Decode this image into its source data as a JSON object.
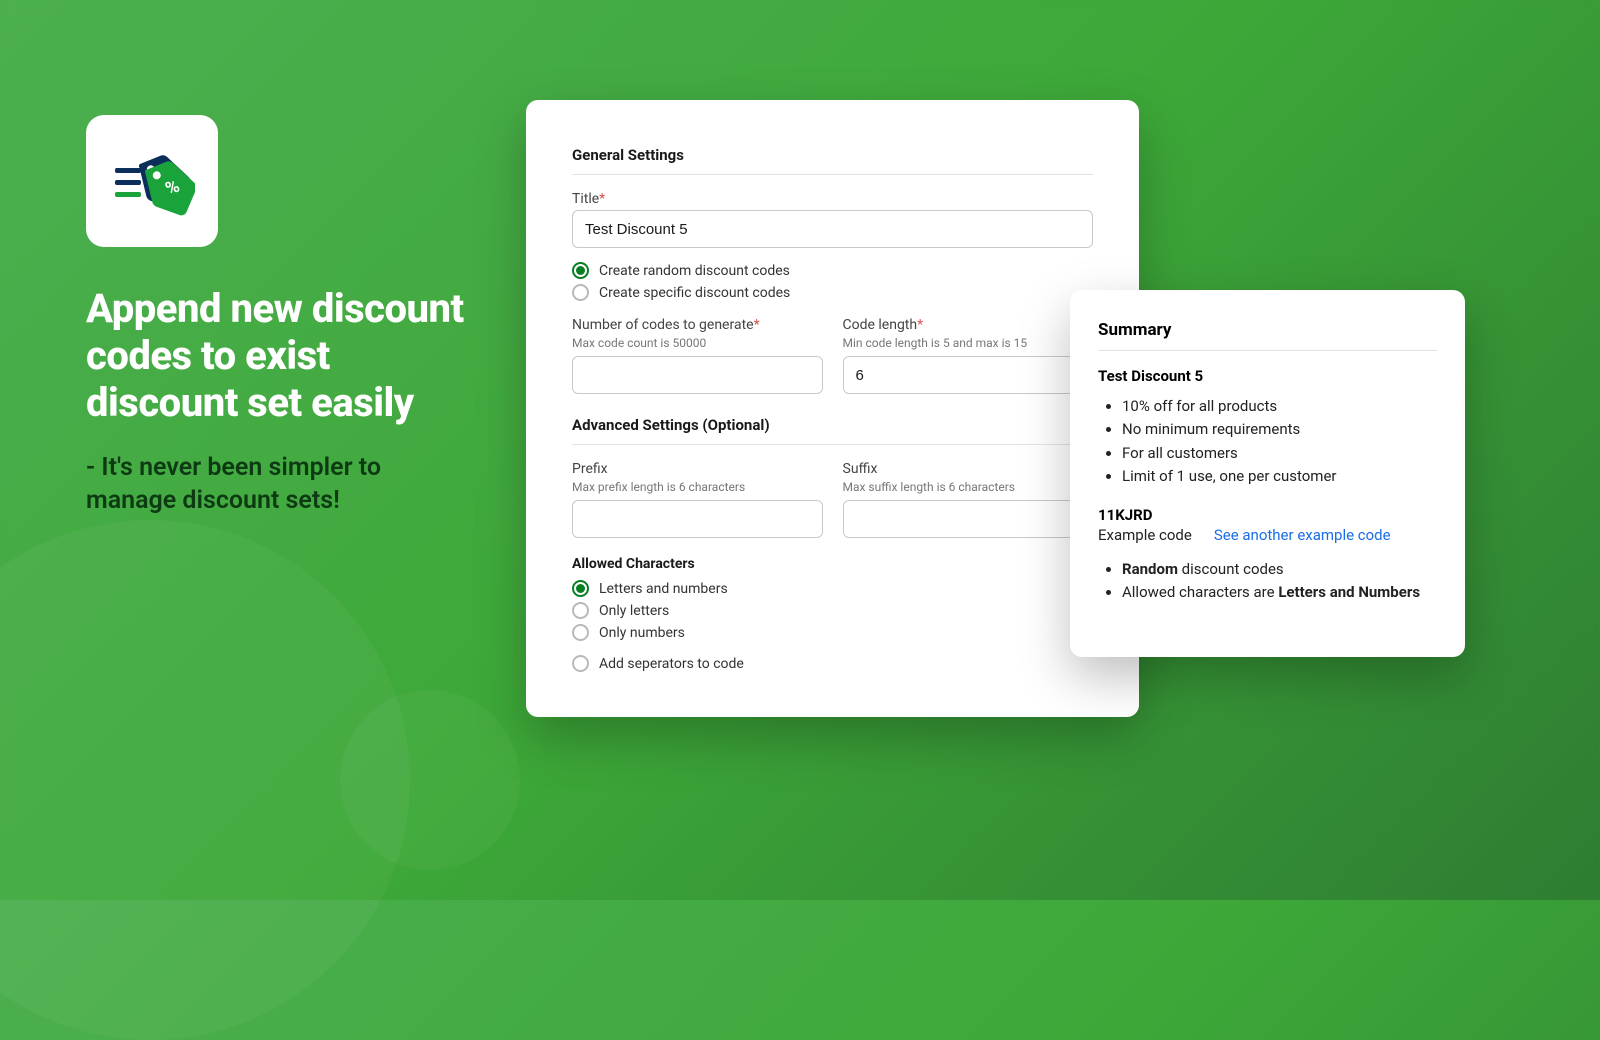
{
  "left": {
    "headline": "Append new discount codes to exist discount set easily",
    "subhead": "- It's never been simpler to manage  discount sets!"
  },
  "form": {
    "general_heading": "General Settings",
    "title_label": "Title",
    "title_value": "Test Discount 5",
    "radio_random": "Create random discount codes",
    "radio_specific": "Create specific discount codes",
    "num_label": "Number of codes to generate",
    "num_helper": "Max code count is 50000",
    "num_value": "",
    "len_label": "Code length",
    "len_helper": "Min code length is 5 and max is 15",
    "len_value": "6",
    "advanced_heading": "Advanced Settings (Optional)",
    "prefix_label": "Prefix",
    "prefix_helper": "Max prefix length is 6 characters",
    "prefix_value": "",
    "suffix_label": "Suffix",
    "suffix_helper": "Max suffix length is 6 characters",
    "suffix_value": "",
    "allowed_heading": "Allowed Characters",
    "opt_letters_numbers": "Letters and numbers",
    "opt_letters": "Only letters",
    "opt_numbers": "Only numbers",
    "opt_separators": "Add seperators to code"
  },
  "summary": {
    "heading": "Summary",
    "name": "Test Discount 5",
    "bullets1": [
      "10% off for all products",
      "No minimum requirements",
      "For all customers",
      "Limit of 1 use, one per customer"
    ],
    "example_code": "11KJRD",
    "example_label": "Example code",
    "see_another": "See another example code",
    "bullets2_prefix1": "Random",
    "bullets2_rest1": " discount codes",
    "bullets2_prefix2": "Allowed characters are ",
    "bullets2_bold2": "Letters and Numbers"
  }
}
